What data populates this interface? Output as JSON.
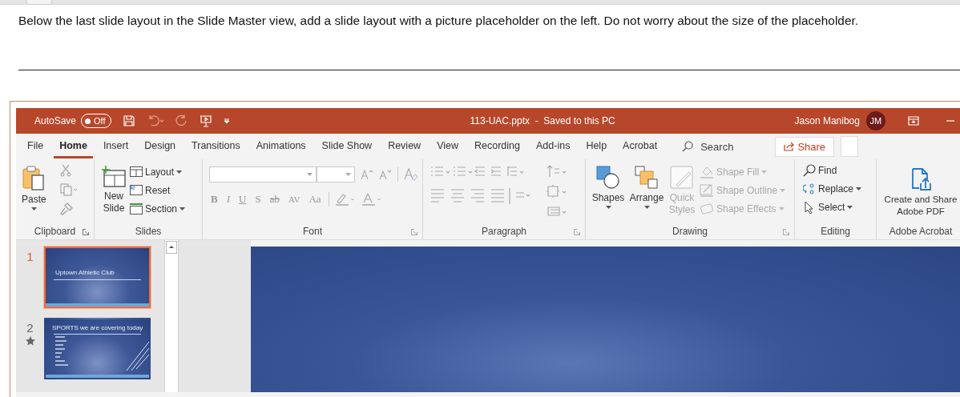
{
  "instruction": "Below the last slide layout in the Slide Master view, add a slide layout with a picture placeholder on the left. Do not worry about the size of the placeholder.",
  "app": {
    "autosave": {
      "label": "AutoSave",
      "state": "Off",
      "on": false
    },
    "title": "113-UAC.pptx  -  Saved to this PC",
    "user": {
      "name": "Jason Manibog",
      "initials": "JM"
    },
    "tabs": [
      {
        "label": "File",
        "selected": false
      },
      {
        "label": "Home",
        "selected": true
      },
      {
        "label": "Insert",
        "selected": false
      },
      {
        "label": "Design",
        "selected": false
      },
      {
        "label": "Transitions",
        "selected": false
      },
      {
        "label": "Animations",
        "selected": false
      },
      {
        "label": "Slide Show",
        "selected": false
      },
      {
        "label": "Review",
        "selected": false
      },
      {
        "label": "View",
        "selected": false
      },
      {
        "label": "Recording",
        "selected": false
      },
      {
        "label": "Add-ins",
        "selected": false
      },
      {
        "label": "Help",
        "selected": false
      },
      {
        "label": "Acrobat",
        "selected": false
      }
    ],
    "search": "Search",
    "share": "Share",
    "ribbon": {
      "clipboard": {
        "label": "Clipboard",
        "paste": "Paste"
      },
      "slides": {
        "label": "Slides",
        "new_slide": "New Slide",
        "layout": "Layout",
        "reset": "Reset",
        "section": "Section"
      },
      "font": {
        "label": "Font",
        "format_buttons": [
          {
            "kind": "bold",
            "label": "B"
          },
          {
            "kind": "italic",
            "label": "I"
          },
          {
            "kind": "underline",
            "label": "U"
          },
          {
            "kind": "shadow",
            "label": "S"
          },
          {
            "kind": "strike",
            "label": "ab"
          },
          {
            "kind": "spacing",
            "label": "AV"
          },
          {
            "kind": "case",
            "label": "Aa"
          }
        ]
      },
      "paragraph": {
        "label": "Paragraph"
      },
      "drawing": {
        "label": "Drawing",
        "shapes": "Shapes",
        "arrange": "Arrange",
        "quick_styles": {
          "label": "Quick Styles",
          "disabled": true
        },
        "shape_items": [
          {
            "kind": "fill",
            "label": "Shape Fill",
            "disabled": true
          },
          {
            "kind": "outline",
            "label": "Shape Outline",
            "disabled": true
          },
          {
            "kind": "effects",
            "label": "Shape Effects",
            "disabled": true
          }
        ]
      },
      "editing": {
        "label": "Editing",
        "items": [
          {
            "kind": "find",
            "label": "Find"
          },
          {
            "kind": "replace",
            "label": "Replace"
          },
          {
            "kind": "select",
            "label": "Select"
          }
        ]
      },
      "acrobat": {
        "label": "Adobe Acrobat",
        "button": "Create and Share Adobe PDF"
      }
    },
    "slides": [
      {
        "number": "1",
        "selected": true,
        "starred": false,
        "kind": "title",
        "title": "Uptown Athletic Club"
      },
      {
        "number": "2",
        "selected": false,
        "starred": true,
        "kind": "list",
        "title": "SPORTS we are covering today"
      }
    ]
  }
}
